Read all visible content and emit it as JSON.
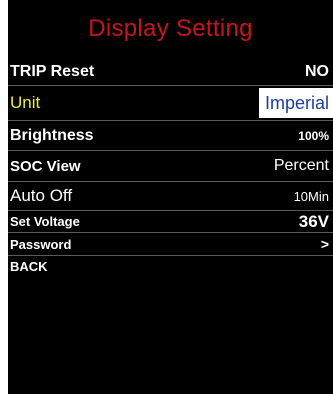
{
  "screen": {
    "title": "Display Setting",
    "colors": {
      "title": "#c8141b",
      "selected_label": "#f3ea2b",
      "selected_value": "#1b3f9c",
      "background": "#000000",
      "text": "#ffffff"
    }
  },
  "menu": {
    "items": [
      {
        "label": "TRIP Reset",
        "value": "NO"
      },
      {
        "label": "Unit",
        "value": "Imperial",
        "selected": true
      },
      {
        "label": "Brightness",
        "value": "100%"
      },
      {
        "label": "SOC View",
        "value": "Percent"
      },
      {
        "label": "Auto Off",
        "value": "10Min"
      },
      {
        "label": "Set Voltage",
        "value": "36V"
      },
      {
        "label": "Password",
        "value": ">"
      },
      {
        "label": "BACK",
        "value": ""
      }
    ]
  }
}
